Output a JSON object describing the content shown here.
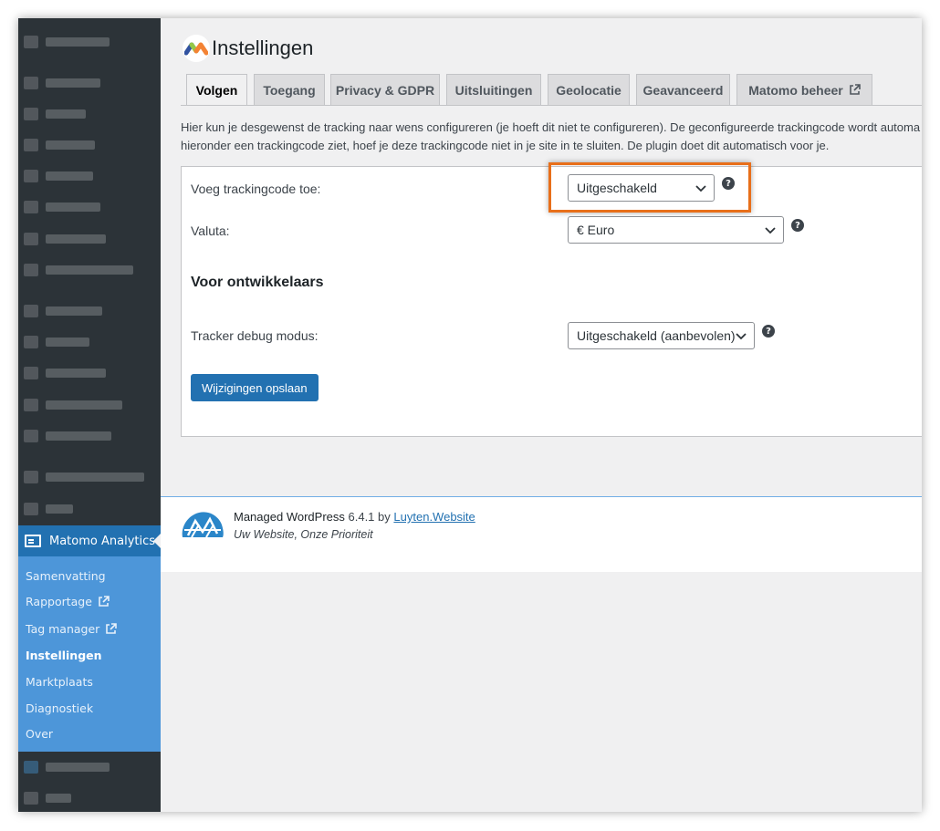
{
  "sidebar": {
    "active_menu": "Matomo Analytics",
    "submenu": [
      {
        "label": "Samenvatting",
        "external": false,
        "current": false
      },
      {
        "label": "Rapportage",
        "external": true,
        "current": false
      },
      {
        "label": "Tag manager",
        "external": true,
        "current": false
      },
      {
        "label": "Instellingen",
        "external": false,
        "current": true
      },
      {
        "label": "Marktplaats",
        "external": false,
        "current": false
      },
      {
        "label": "Diagnostiek",
        "external": false,
        "current": false
      },
      {
        "label": "Over",
        "external": false,
        "current": false
      }
    ]
  },
  "page": {
    "title": "Instellingen",
    "tabs": [
      {
        "label": "Volgen",
        "active": true
      },
      {
        "label": "Toegang",
        "active": false
      },
      {
        "label": "Privacy & GDPR",
        "active": false
      },
      {
        "label": "Uitsluitingen",
        "active": false
      },
      {
        "label": "Geolocatie",
        "active": false
      },
      {
        "label": "Geavanceerd",
        "active": false
      },
      {
        "label": "Matomo beheer",
        "active": false,
        "external": true
      }
    ],
    "description_line1": "Hier kun je desgewenst de tracking naar wens configureren (je hoeft dit niet te configureren). De geconfigureerde trackingcode wordt automa",
    "description_line2": "hieronder een trackingcode ziet, hoef je deze trackingcode niet in je site in te sluiten. De plugin doet dit automatisch voor je."
  },
  "form": {
    "tracking_label": "Voeg trackingcode toe:",
    "tracking_value": "Uitgeschakeld",
    "currency_label": "Valuta:",
    "currency_value": "€ Euro",
    "dev_heading": "Voor ontwikkelaars",
    "debug_label": "Tracker debug modus:",
    "debug_value": "Uitgeschakeld (aanbevolen)",
    "help_glyph": "?",
    "save_label": "Wijzigingen opslaan"
  },
  "footer": {
    "product": "Managed WordPress",
    "version": "6.4.1",
    "by": "by",
    "link_text": "Luyten.Website",
    "tagline": "Uw Website, Onze Prioriteit"
  },
  "colors": {
    "accent": "#2271b1",
    "highlight": "#e86f1a",
    "sidebar_bg": "#2c3338",
    "submenu_bg": "#4d96d9"
  }
}
